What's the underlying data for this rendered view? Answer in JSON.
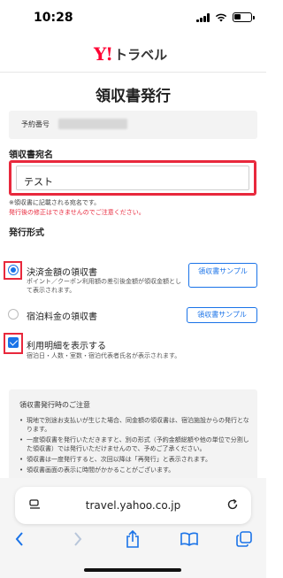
{
  "status_bar": {
    "time": "10:28"
  },
  "header": {
    "logo_mark": "Y!",
    "logo_text": "トラベル"
  },
  "page": {
    "title": "領収書発行",
    "reservation_label": "予約番号",
    "recipient_label": "領収書宛名",
    "recipient_value": "テスト",
    "note_line1": "※領収書に記載される宛名です。",
    "note_line2": "発行後の修正はできませんのでご注意ください。",
    "format_label": "発行形式"
  },
  "options": [
    {
      "title": "決済金額の領収書",
      "desc": "ポイント／クーポン利用額の差引後金額が領収金額として表示されます。",
      "button": "領収書サンプル",
      "selected": true
    },
    {
      "title": "宿泊料金の領収書",
      "desc": "",
      "button": "領収書サンプル",
      "selected": false
    }
  ],
  "details_checkbox": {
    "label": "利用明細を表示する",
    "desc": "宿泊日・人数・室数・宿泊代表者氏名が表示されます。",
    "checked": true
  },
  "notice": {
    "title": "領収書発行時のご注意",
    "items": [
      "現地で別途お支払いが生じた場合、同金額の領収書は、宿泊施設からの発行となります。",
      "一度領収書を発行いただきますと、別の形式（予約金額総額や他の単位で分割した領収書）では発行いただけませんので、予めご了承ください。",
      "領収書は一度発行すると、次回以降は「再発行」と表示されます。",
      "領収書画面の表示に時間がかかることがございます。"
    ]
  },
  "browser": {
    "url": "travel.yahoo.co.jp"
  },
  "colors": {
    "accent": "#1a73e8",
    "highlight": "#e8283c",
    "brand": "#ff0033"
  }
}
